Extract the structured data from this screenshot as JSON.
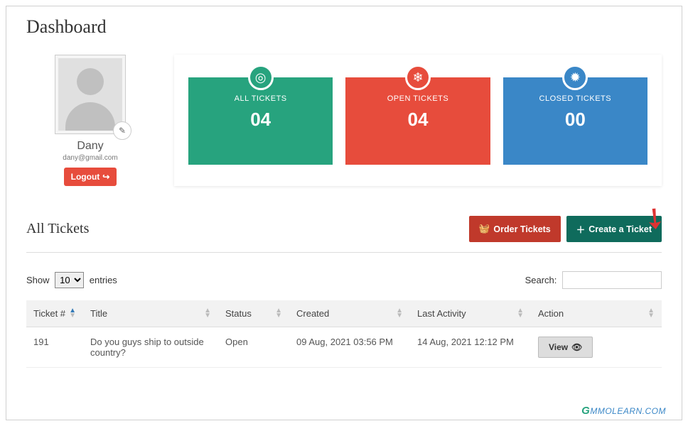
{
  "page": {
    "title": "Dashboard"
  },
  "profile": {
    "name": "Dany",
    "email": "dany@gmail.com",
    "logout_label": "Logout"
  },
  "stats": [
    {
      "label": "ALL TICKETS",
      "value": "04",
      "color": "green",
      "icon": "target"
    },
    {
      "label": "OPEN TICKETS",
      "value": "04",
      "color": "red",
      "icon": "snowflake"
    },
    {
      "label": "CLOSED TICKETS",
      "value": "00",
      "color": "blue",
      "icon": "seal"
    }
  ],
  "section": {
    "title": "All Tickets",
    "order_btn": "Order Tickets",
    "create_btn": "Create a Ticket"
  },
  "table": {
    "show_label_prefix": "Show",
    "show_label_suffix": "entries",
    "show_value": "10",
    "search_label": "Search:",
    "columns": [
      "Ticket #",
      "Title",
      "Status",
      "Created",
      "Last Activity",
      "Action"
    ],
    "rows": [
      {
        "id": "191",
        "title": "Do you guys ship to outside country?",
        "status": "Open",
        "created": "09 Aug, 2021 03:56 PM",
        "last_activity": "14 Aug, 2021 12:12 PM",
        "action_label": "View"
      }
    ]
  },
  "watermark": "MMOLEARN.COM"
}
